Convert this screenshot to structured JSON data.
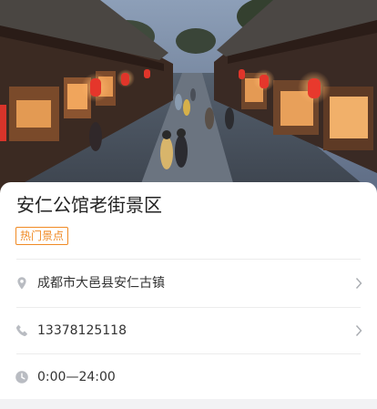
{
  "hero": {
    "image_name": "ancient-street-night-photo",
    "icon": "street-photo"
  },
  "place": {
    "title": "安仁公馆老街景区",
    "tag": "热门景点",
    "tag_color": "#f08a24"
  },
  "info": {
    "address": {
      "icon": "location-pin-icon",
      "text": "成都市大邑县安仁古镇"
    },
    "phone": {
      "icon": "phone-icon",
      "text": "13378125118"
    },
    "hours": {
      "icon": "clock-icon",
      "text": "0:00—24:00"
    }
  },
  "colors": {
    "title": "#222222",
    "text": "#333333",
    "icon": "#b9bcc2",
    "divider": "#ececec",
    "background": "#f2f2f4"
  }
}
